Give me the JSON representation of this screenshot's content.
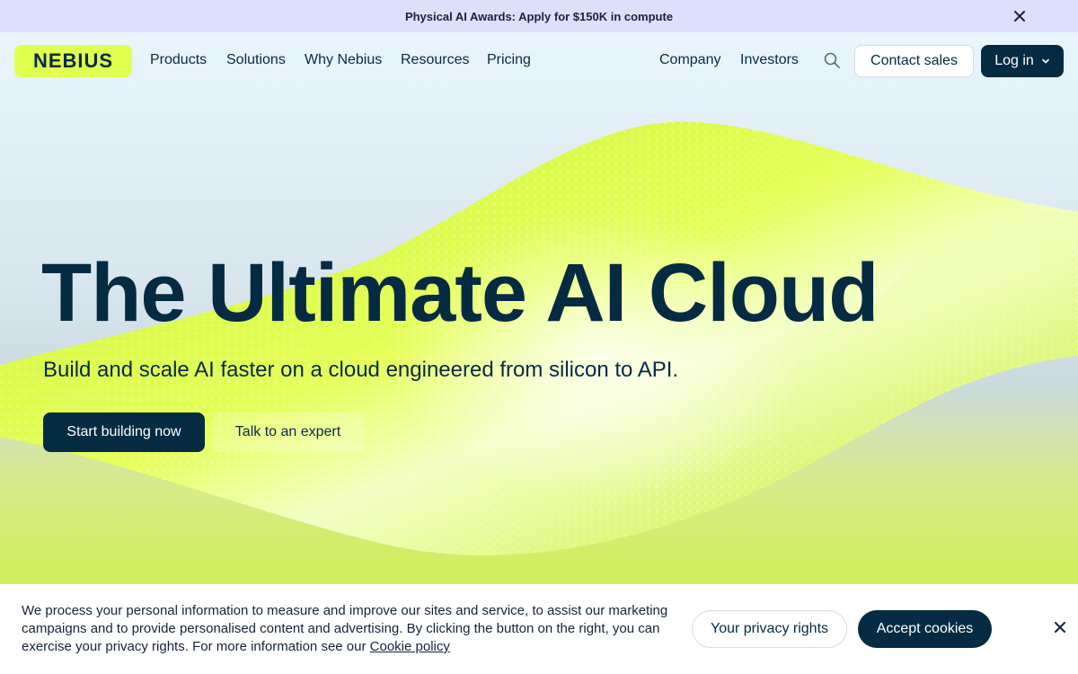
{
  "announcement": {
    "text": "Physical AI Awards: Apply for $150K in compute",
    "close_icon": "close-icon"
  },
  "nav": {
    "logo": "NEBIUS",
    "left_links": [
      "Products",
      "Solutions",
      "Why Nebius",
      "Resources",
      "Pricing"
    ],
    "right_links": [
      "Company",
      "Investors"
    ],
    "search_icon": "search-icon",
    "contact_label": "Contact sales",
    "login_label": "Log in",
    "login_icon": "chevron-down-icon"
  },
  "hero": {
    "title": "The Ultimate AI Cloud",
    "subtitle": "Build and scale AI faster on a cloud engineered from silicon to API.",
    "primary_cta": "Start building now",
    "secondary_cta": "Talk to an expert"
  },
  "cookie": {
    "text": "We process your personal information to measure and improve our sites and service, to assist our marketing campaigns and to provide personalised content and advertising. By clicking the button on the right, you can exercise your privacy rights. For more information see our",
    "link": "Cookie policy",
    "privacy_label": "Your privacy rights",
    "accept_label": "Accept cookies",
    "close_icon": "close-icon"
  },
  "colors": {
    "brand_lime": "#e0ff4f",
    "navy": "#052b42",
    "announce_bg": "#dde0fc"
  }
}
